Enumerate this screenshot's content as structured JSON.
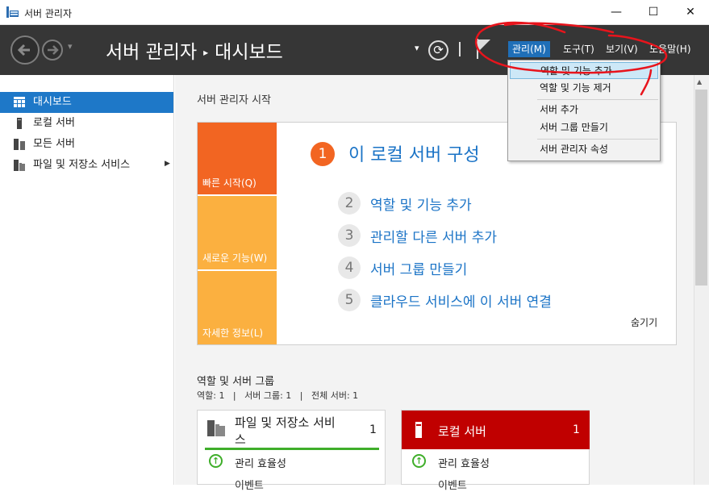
{
  "window": {
    "title": "서버 관리자",
    "minimize_glyph": "—",
    "maximize_glyph": "☐",
    "close_glyph": "✕"
  },
  "header": {
    "breadcrumb_app": "서버 관리자",
    "breadcrumb_separator": "▸",
    "breadcrumb_page": "대시보드",
    "dropdown_glyph": "▾",
    "refresh_glyph": "⟳",
    "menus": {
      "manage": "관리(M)",
      "tools": "도구(T)",
      "view": "보기(V)",
      "help": "도움말(H)"
    }
  },
  "manage_menu": {
    "items": [
      "역할 및 기능 추가",
      "역할 및 기능 제거",
      "서버 추가",
      "서버 그룹 만들기",
      "서버 관리자 속성"
    ],
    "highlighted": "역할 및 기능 추가"
  },
  "sidebar": {
    "items": [
      {
        "label": "대시보드",
        "icon": "dashboard-icon",
        "active": true
      },
      {
        "label": "로컬 서버",
        "icon": "server-icon"
      },
      {
        "label": "모든 서버",
        "icon": "servers-icon"
      },
      {
        "label": "파일 및 저장소 서비스",
        "icon": "file-storage-icon",
        "has_submenu": true
      }
    ],
    "submenu_arrow": "▶"
  },
  "welcome": {
    "heading": "서버 관리자 시작",
    "tiles": [
      "빠른 시작(Q)",
      "새로운 기능(W)",
      "자세한 정보(L)"
    ],
    "steps": [
      {
        "num": "1",
        "label": "이 로컬 서버 구성"
      },
      {
        "num": "2",
        "label": "역할 및 기능 추가"
      },
      {
        "num": "3",
        "label": "관리할 다른 서버 추가"
      },
      {
        "num": "4",
        "label": "서버 그룹 만들기"
      },
      {
        "num": "5",
        "label": "클라우드 서비스에 이 서버 연결"
      }
    ],
    "hide_label": "숨기기"
  },
  "roles": {
    "heading": "역할 및 서버 그룹",
    "counts": "역할: 1   |   서버 그룹: 1   |   전체 서버: 1"
  },
  "cards": [
    {
      "title_line1": "파일 및 저장소 서비",
      "title_line2": "스",
      "count": "1",
      "row1": "관리 효율성",
      "row2": "이벤트"
    },
    {
      "title_line1": "로컬 서버",
      "count": "1",
      "row1": "관리 효율성",
      "row2": "이벤트",
      "color": "#c00000"
    }
  ],
  "colors": {
    "header_bg": "#363636",
    "accent_blue": "#1e78c8",
    "quick_start_orange": "#f26522",
    "tile_yellow": "#fbb040",
    "status_green": "#3fae2a",
    "local_server_red": "#c00000",
    "annotation_red": "#e8141c"
  }
}
